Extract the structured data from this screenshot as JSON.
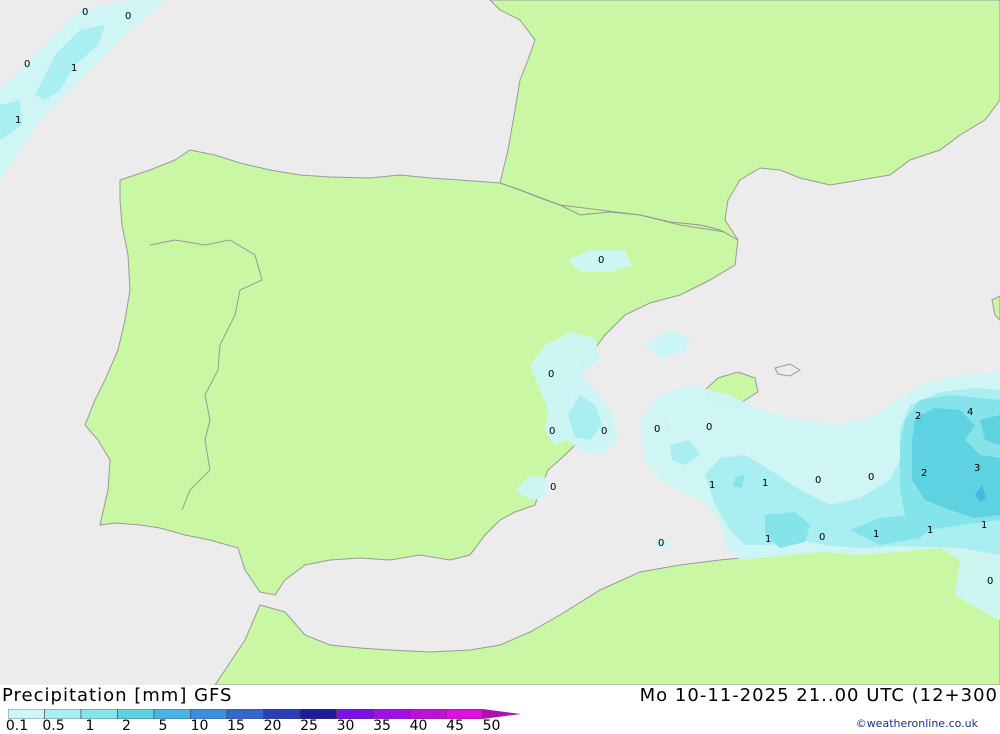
{
  "title": {
    "left": "Precipitation [mm] GFS",
    "right": "Mo 10-11-2025 21..00 UTC (12+300"
  },
  "credit": "©weatheronline.co.uk",
  "legend": {
    "ticks": [
      "0.1",
      "0.5",
      "1",
      "2",
      "5",
      "10",
      "15",
      "20",
      "25",
      "30",
      "35",
      "40",
      "45",
      "50"
    ],
    "colors": [
      "#cdf6f6",
      "#a9eef0",
      "#85e3ea",
      "#5fd2e2",
      "#4ab4e4",
      "#3c8fdc",
      "#3566cc",
      "#2a3fb4",
      "#1c1c96",
      "#7a12e6",
      "#a010e6",
      "#c010d8",
      "#e010e0",
      "#b010b0"
    ]
  },
  "map_colors": {
    "sea": "#ececec",
    "land": "#c9f7a3",
    "border": "#9a9a9a"
  },
  "contour_labels": [
    {
      "id": "v1",
      "text": "0"
    },
    {
      "id": "v2",
      "text": "0"
    },
    {
      "id": "v3",
      "text": "0"
    },
    {
      "id": "v4",
      "text": "1"
    },
    {
      "id": "v5",
      "text": "1"
    },
    {
      "id": "v6",
      "text": "0"
    },
    {
      "id": "v7",
      "text": "0"
    },
    {
      "id": "v8",
      "text": "0"
    },
    {
      "id": "v9",
      "text": "0"
    },
    {
      "id": "v10",
      "text": "0"
    },
    {
      "id": "v11",
      "text": "0"
    },
    {
      "id": "v12",
      "text": "0"
    },
    {
      "id": "v13",
      "text": "1"
    },
    {
      "id": "v14",
      "text": "1"
    },
    {
      "id": "v15",
      "text": "0"
    },
    {
      "id": "v16",
      "text": "0"
    },
    {
      "id": "v17",
      "text": "2"
    },
    {
      "id": "v18",
      "text": "4"
    },
    {
      "id": "v19",
      "text": "2"
    },
    {
      "id": "v20",
      "text": "3"
    },
    {
      "id": "v21",
      "text": "0"
    },
    {
      "id": "v22",
      "text": "1"
    },
    {
      "id": "v23",
      "text": "0"
    },
    {
      "id": "v24",
      "text": "1"
    },
    {
      "id": "v25",
      "text": "1"
    },
    {
      "id": "v26",
      "text": "1"
    },
    {
      "id": "v27",
      "text": "0"
    }
  ]
}
